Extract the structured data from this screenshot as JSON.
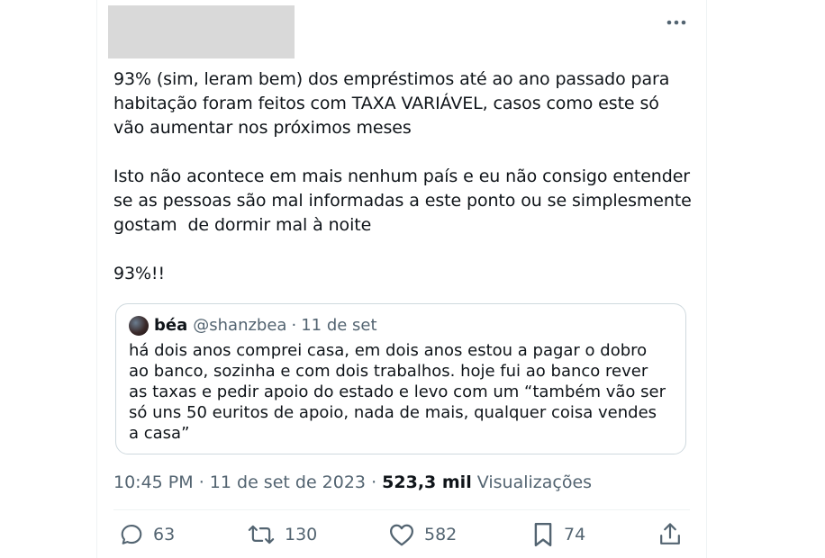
{
  "header": {
    "more_icon": "more-horizontal-icon"
  },
  "tweet": {
    "text": "93% (sim, leram bem) dos empréstimos até ao ano passado para\nhabitação foram feitos com TAXA VARIÁVEL, casos como este só\nvão aumentar nos próximos meses\n\nIsto não acontece em mais nenhum país e eu não consigo entender\nse as pessoas são mal informadas a este ponto ou se simplesmente\ngostam  de dormir mal à noite\n\n93%!!"
  },
  "quote": {
    "name": "béa",
    "handle": "@shanzbea",
    "separator": "·",
    "date": "11 de set",
    "text": "há dois anos comprei casa, em dois anos estou a pagar o dobro\nao banco, sozinha e com dois trabalhos. hoje fui ao banco rever\nas taxas e pedir apoio do estado e levo com um “também vão ser\nsó uns 50 euritos de apoio, nada de mais, qualquer coisa vendes\na casa”"
  },
  "meta": {
    "time": "10:45 PM",
    "separator": "·",
    "date": "11 de set de 2023",
    "separator2": "·",
    "views_count": "523,3 mil",
    "views_label": "Visualizações"
  },
  "actions": {
    "replies": "63",
    "retweets": "130",
    "likes": "582",
    "bookmarks": "74"
  },
  "colors": {
    "text": "#0f1419",
    "secondary": "#536471",
    "border": "#cfd9de"
  }
}
